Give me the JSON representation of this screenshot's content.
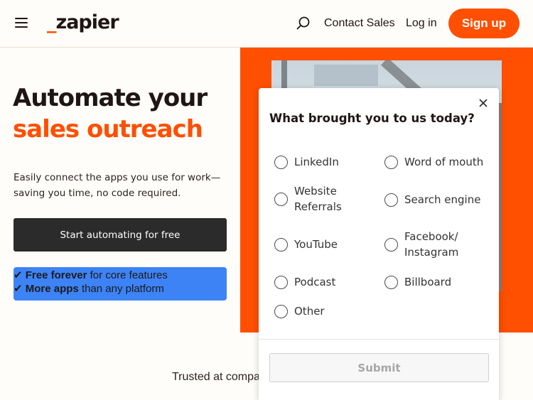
{
  "header": {
    "logo_prefix": "_",
    "logo_text": "zapier",
    "contact_sales": "Contact Sales",
    "login": "Log in",
    "signup": "Sign up"
  },
  "hero": {
    "title_line1": "Automate your",
    "title_line2": "sales outreach",
    "subtitle": "Easily connect the apps you use for work—saving you time, no code required.",
    "cta": "Start automating for free",
    "features": [
      {
        "check": "✔",
        "bold": "Free forever",
        "rest": "for core features"
      },
      {
        "check": "✔",
        "bold": "More apps",
        "rest": "than any platform"
      }
    ],
    "trusted": "Trusted at compa"
  },
  "modal": {
    "title": "What brought you to us today?",
    "options": [
      {
        "label": "LinkedIn",
        "checked": false
      },
      {
        "label": "Word of mouth",
        "checked": false
      },
      {
        "label": "Website\nReferrals",
        "checked": false
      },
      {
        "label": "Search engine",
        "checked": false
      },
      {
        "label": "YouTube",
        "checked": false
      },
      {
        "label": "Facebook/\nInstagram",
        "checked": false
      },
      {
        "label": "Podcast",
        "checked": false
      },
      {
        "label": "Billboard",
        "checked": false
      },
      {
        "label": "Other",
        "checked": false
      }
    ],
    "submit": "Submit"
  },
  "colors": {
    "brand_orange": "#ff4f00",
    "cta_dark": "#2b2b2b",
    "feature_blue": "#3d83f5",
    "background": "#fffdf9"
  },
  "icons": [
    "menu-icon",
    "search-icon",
    "close-icon",
    "check-icon"
  ]
}
